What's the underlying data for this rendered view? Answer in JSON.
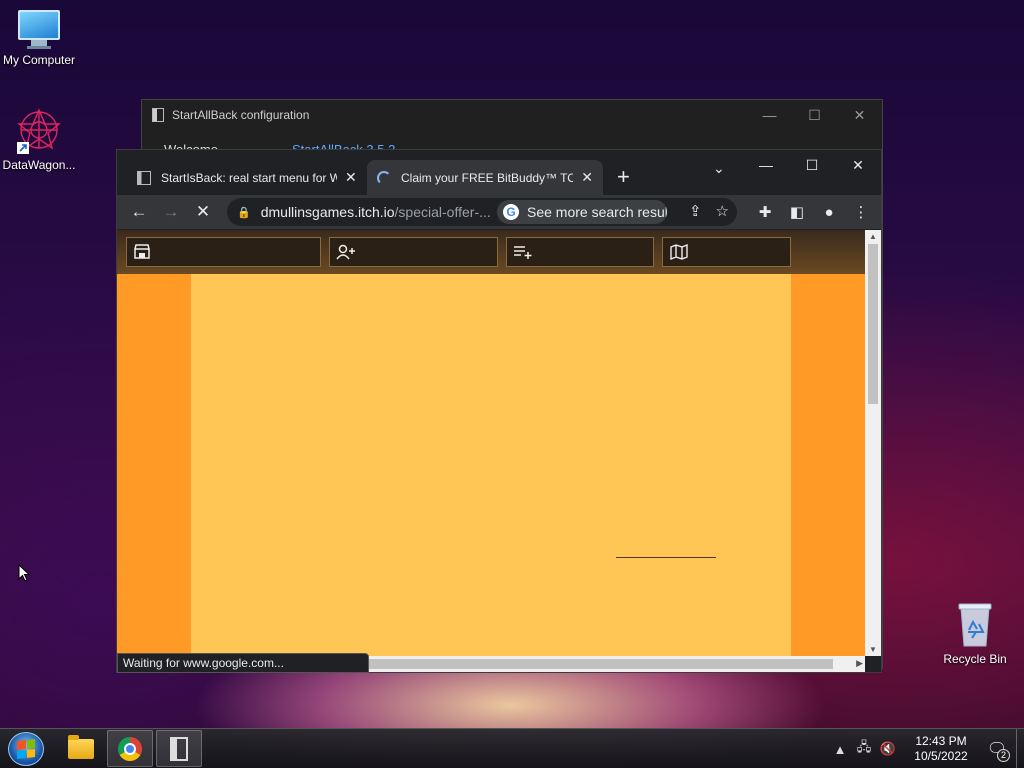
{
  "desktop": {
    "icons": [
      {
        "label": "My Computer"
      },
      {
        "label": "DataWagon..."
      },
      {
        "label": "Recycle Bin"
      }
    ]
  },
  "sab_window": {
    "title": "StartAllBack configuration",
    "nav_item": "Welcome",
    "version_text": "StartAllBack 3.5.2",
    "controls": {
      "minimize": "—",
      "maximize": "☐",
      "close": "✕"
    }
  },
  "chrome": {
    "tabs": [
      {
        "title": "StartIsBack: real start menu for Windows",
        "icon": "document-icon",
        "active": false
      },
      {
        "title": "Claim your FREE BitBuddy™ TODAY",
        "icon": "loading-spinner-icon",
        "active": true
      }
    ],
    "new_tab": "+",
    "tab_search": "⌄",
    "window_controls": {
      "minimize": "—",
      "maximize": "☐",
      "close": "✕"
    },
    "nav": {
      "back": "←",
      "forward": "→",
      "stop": "✕"
    },
    "omnibox": {
      "domain": "dmullinsgames.itch.io",
      "path": "/special-offer-...",
      "search_chip": "See more search results"
    },
    "status_text": "Waiting for www.google.com...",
    "page": {
      "bar_colors": {
        "top": "#3a2a1c",
        "bottom": "#6b4a23"
      },
      "content_color": "#ffc656",
      "side_color": "#ff9a26"
    }
  },
  "taskbar": {
    "time": "12:43 PM",
    "date": "10/5/2022",
    "notification_count": "2",
    "tray_arrow": "▲"
  }
}
